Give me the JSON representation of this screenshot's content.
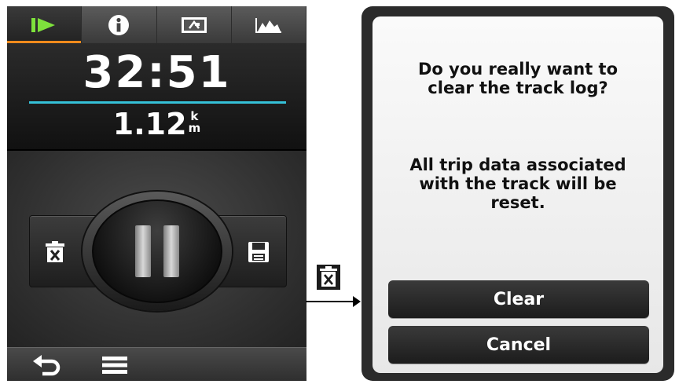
{
  "left_screen": {
    "tabs": [
      {
        "icon": "play-icon",
        "active": true
      },
      {
        "icon": "info-icon",
        "active": false
      },
      {
        "icon": "map-icon",
        "active": false
      },
      {
        "icon": "elevation-icon",
        "active": false
      }
    ],
    "timer": "32:51",
    "distance": "1.12",
    "distance_unit_top": "k",
    "distance_unit_bottom": "m",
    "controls": {
      "left_icon": "trash-icon",
      "center_icon": "pause-icon",
      "right_icon": "save-icon"
    },
    "bottom_bar": {
      "back_icon": "back-icon",
      "menu_icon": "menu-icon"
    }
  },
  "transition_icon": "trash-icon",
  "dialog": {
    "question": "Do you really want to clear the track log?",
    "info": "All trip data associated with the track will be reset.",
    "clear_label": "Clear",
    "cancel_label": "Cancel"
  },
  "colors": {
    "active_tab_accent": "#f08a1c",
    "play_icon": "#7ee23c",
    "timer_divider": "#35c1d8"
  }
}
